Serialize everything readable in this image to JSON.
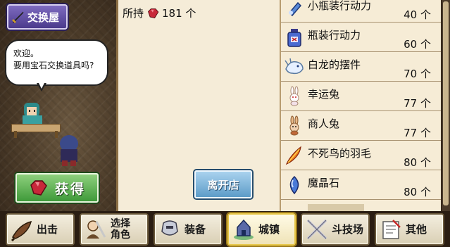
{
  "shop": {
    "title": "交换屋",
    "greeting_line1": "欢迎。",
    "greeting_line2": "要用宝石交换道具吗?",
    "get_button": "获得"
  },
  "wallet": {
    "label": "所持",
    "gems": "181 个"
  },
  "leave_button": "离开店",
  "items": [
    {
      "name": "小瓶装行动力",
      "count": "40 个",
      "icon": "small-potion-icon"
    },
    {
      "name": "瓶装行动力",
      "count": "60 个",
      "icon": "potion-bottle-icon"
    },
    {
      "name": "白龙的摆件",
      "count": "70 个",
      "icon": "white-dragon-figurine-icon"
    },
    {
      "name": "幸运兔",
      "count": "77 个",
      "icon": "lucky-rabbit-icon"
    },
    {
      "name": "商人兔",
      "count": "77 个",
      "icon": "merchant-rabbit-icon"
    },
    {
      "name": "不死鸟的羽毛",
      "count": "80 个",
      "icon": "phoenix-feather-icon"
    },
    {
      "name": "魔晶石",
      "count": "80 个",
      "icon": "magic-crystal-icon"
    }
  ],
  "nav": [
    {
      "label": "出击",
      "icon": "sortie-icon"
    },
    {
      "label": "选择角色",
      "line1": "选择",
      "line2": "角色",
      "icon": "character-select-icon"
    },
    {
      "label": "装备",
      "icon": "equipment-icon"
    },
    {
      "label": "城镇",
      "icon": "town-icon",
      "active": true
    },
    {
      "label": "斗技场",
      "icon": "arena-icon"
    },
    {
      "label": "其他",
      "icon": "other-icon"
    }
  ],
  "colors": {
    "gem": "#c8283a",
    "title_bg": "#5b4aa0",
    "get_button_bg": "#4fa84a",
    "leave_button_bg": "#6fa8d4",
    "active_nav_border": "#e8c84a"
  }
}
